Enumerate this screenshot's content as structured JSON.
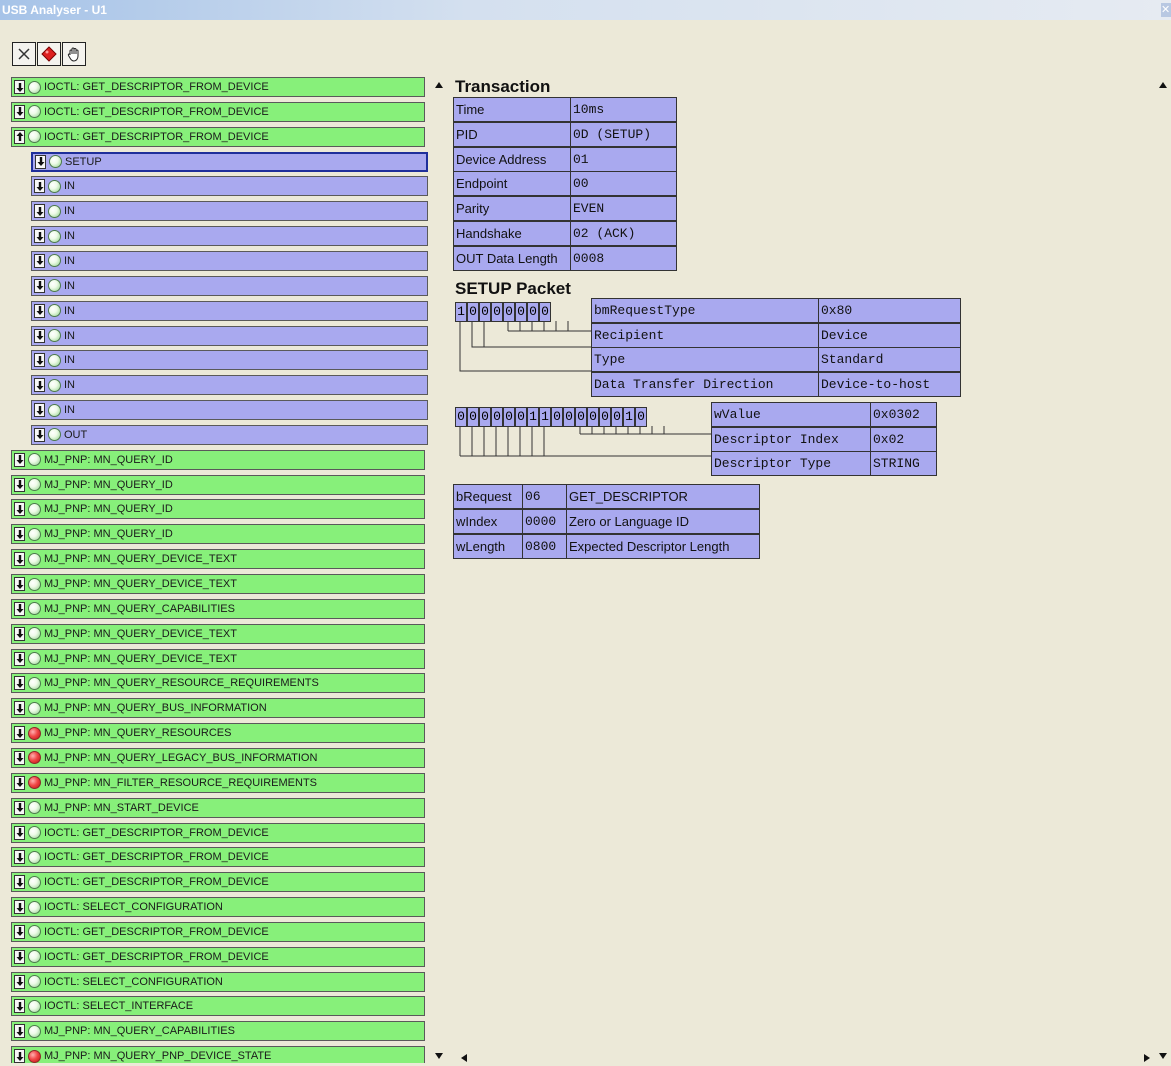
{
  "window": {
    "title": "USB Analyser - U1"
  },
  "toolbar": {
    "buttons": [
      {
        "name": "clear",
        "icon": "x-icon"
      },
      {
        "name": "stop",
        "icon": "stop-diamond-icon",
        "color": "#dd1f1f"
      },
      {
        "name": "pause",
        "icon": "hand-icon"
      }
    ]
  },
  "tree": {
    "rows": [
      {
        "label": "IOCTL: GET_DESCRIPTOR_FROM_DEVICE",
        "color": "green",
        "dir": "down",
        "led": "green",
        "indent": 0
      },
      {
        "label": "IOCTL: GET_DESCRIPTOR_FROM_DEVICE",
        "color": "green",
        "dir": "down",
        "led": "green",
        "indent": 0
      },
      {
        "label": "IOCTL: GET_DESCRIPTOR_FROM_DEVICE",
        "color": "green",
        "dir": "up",
        "led": "green",
        "indent": 0
      },
      {
        "label": "SETUP",
        "color": "blue",
        "dir": "down",
        "led": "green",
        "indent": 1,
        "selected": true
      },
      {
        "label": "IN",
        "color": "blue",
        "dir": "down",
        "led": "green",
        "indent": 1
      },
      {
        "label": "IN",
        "color": "blue",
        "dir": "down",
        "led": "green",
        "indent": 1
      },
      {
        "label": "IN",
        "color": "blue",
        "dir": "down",
        "led": "green",
        "indent": 1
      },
      {
        "label": "IN",
        "color": "blue",
        "dir": "down",
        "led": "green",
        "indent": 1
      },
      {
        "label": "IN",
        "color": "blue",
        "dir": "down",
        "led": "green",
        "indent": 1
      },
      {
        "label": "IN",
        "color": "blue",
        "dir": "down",
        "led": "green",
        "indent": 1
      },
      {
        "label": "IN",
        "color": "blue",
        "dir": "down",
        "led": "green",
        "indent": 1
      },
      {
        "label": "IN",
        "color": "blue",
        "dir": "down",
        "led": "green",
        "indent": 1
      },
      {
        "label": "IN",
        "color": "blue",
        "dir": "down",
        "led": "green",
        "indent": 1
      },
      {
        "label": "IN",
        "color": "blue",
        "dir": "down",
        "led": "green",
        "indent": 1
      },
      {
        "label": "OUT",
        "color": "blue",
        "dir": "down",
        "led": "green",
        "indent": 1
      },
      {
        "label": "MJ_PNP: MN_QUERY_ID",
        "color": "green",
        "dir": "down",
        "led": "green",
        "indent": 0
      },
      {
        "label": "MJ_PNP: MN_QUERY_ID",
        "color": "green",
        "dir": "down",
        "led": "green",
        "indent": 0
      },
      {
        "label": "MJ_PNP: MN_QUERY_ID",
        "color": "green",
        "dir": "down",
        "led": "green",
        "indent": 0
      },
      {
        "label": "MJ_PNP: MN_QUERY_ID",
        "color": "green",
        "dir": "down",
        "led": "green",
        "indent": 0
      },
      {
        "label": "MJ_PNP: MN_QUERY_DEVICE_TEXT",
        "color": "green",
        "dir": "down",
        "led": "green",
        "indent": 0
      },
      {
        "label": "MJ_PNP: MN_QUERY_DEVICE_TEXT",
        "color": "green",
        "dir": "down",
        "led": "green",
        "indent": 0
      },
      {
        "label": "MJ_PNP: MN_QUERY_CAPABILITIES",
        "color": "green",
        "dir": "down",
        "led": "green",
        "indent": 0
      },
      {
        "label": "MJ_PNP: MN_QUERY_DEVICE_TEXT",
        "color": "green",
        "dir": "down",
        "led": "green",
        "indent": 0
      },
      {
        "label": "MJ_PNP: MN_QUERY_DEVICE_TEXT",
        "color": "green",
        "dir": "down",
        "led": "green",
        "indent": 0
      },
      {
        "label": "MJ_PNP: MN_QUERY_RESOURCE_REQUIREMENTS",
        "color": "green",
        "dir": "down",
        "led": "green",
        "indent": 0
      },
      {
        "label": "MJ_PNP: MN_QUERY_BUS_INFORMATION",
        "color": "green",
        "dir": "down",
        "led": "green",
        "indent": 0
      },
      {
        "label": "MJ_PNP: MN_QUERY_RESOURCES",
        "color": "green",
        "dir": "down",
        "led": "red",
        "indent": 0
      },
      {
        "label": "MJ_PNP: MN_QUERY_LEGACY_BUS_INFORMATION",
        "color": "green",
        "dir": "down",
        "led": "red",
        "indent": 0
      },
      {
        "label": "MJ_PNP: MN_FILTER_RESOURCE_REQUIREMENTS",
        "color": "green",
        "dir": "down",
        "led": "red",
        "indent": 0
      },
      {
        "label": "MJ_PNP: MN_START_DEVICE",
        "color": "green",
        "dir": "down",
        "led": "green",
        "indent": 0
      },
      {
        "label": "IOCTL: GET_DESCRIPTOR_FROM_DEVICE",
        "color": "green",
        "dir": "down",
        "led": "green",
        "indent": 0
      },
      {
        "label": "IOCTL: GET_DESCRIPTOR_FROM_DEVICE",
        "color": "green",
        "dir": "down",
        "led": "green",
        "indent": 0
      },
      {
        "label": "IOCTL: GET_DESCRIPTOR_FROM_DEVICE",
        "color": "green",
        "dir": "down",
        "led": "green",
        "indent": 0
      },
      {
        "label": "IOCTL: SELECT_CONFIGURATION",
        "color": "green",
        "dir": "down",
        "led": "green",
        "indent": 0
      },
      {
        "label": "IOCTL: GET_DESCRIPTOR_FROM_DEVICE",
        "color": "green",
        "dir": "down",
        "led": "green",
        "indent": 0
      },
      {
        "label": "IOCTL: GET_DESCRIPTOR_FROM_DEVICE",
        "color": "green",
        "dir": "down",
        "led": "green",
        "indent": 0
      },
      {
        "label": "IOCTL: SELECT_CONFIGURATION",
        "color": "green",
        "dir": "down",
        "led": "green",
        "indent": 0
      },
      {
        "label": "IOCTL: SELECT_INTERFACE",
        "color": "green",
        "dir": "down",
        "led": "green",
        "indent": 0
      },
      {
        "label": "MJ_PNP: MN_QUERY_CAPABILITIES",
        "color": "green",
        "dir": "down",
        "led": "green",
        "indent": 0
      },
      {
        "label": "MJ_PNP: MN_QUERY_PNP_DEVICE_STATE",
        "color": "green",
        "dir": "down",
        "led": "red",
        "indent": 0
      }
    ]
  },
  "transaction": {
    "heading": "Transaction",
    "rows": [
      {
        "label": "Time",
        "value": "10ms"
      },
      {
        "label": "PID",
        "value": "0D (SETUP)"
      },
      {
        "label": "Device Address",
        "value": "01"
      },
      {
        "label": "Endpoint",
        "value": "00"
      },
      {
        "label": "Parity",
        "value": "EVEN"
      },
      {
        "label": "Handshake",
        "value": "02 (ACK)"
      },
      {
        "label": "OUT Data Length",
        "value": "0008"
      }
    ]
  },
  "setup": {
    "heading": "SETUP Packet",
    "bmRequestType": {
      "bits": [
        "1",
        "0",
        "0",
        "0",
        "0",
        "0",
        "0",
        "0"
      ],
      "rows": [
        {
          "label": "bmRequestType",
          "value": "0x80"
        },
        {
          "label": "Recipient",
          "value": "Device"
        },
        {
          "label": "Type",
          "value": "Standard"
        },
        {
          "label": "Data Transfer Direction",
          "value": "Device-to-host"
        }
      ]
    },
    "wValue": {
      "bits": [
        "0",
        "0",
        "0",
        "0",
        "0",
        "0",
        "1",
        "1",
        "0",
        "0",
        "0",
        "0",
        "0",
        "0",
        "1",
        "0"
      ],
      "rows": [
        {
          "label": "wValue",
          "value": "0x0302"
        },
        {
          "label": "Descriptor Index",
          "value": "0x02"
        },
        {
          "label": "Descriptor Type",
          "value": "STRING"
        }
      ]
    },
    "fields": [
      {
        "name": "bRequest",
        "value": "06",
        "desc": "GET_DESCRIPTOR"
      },
      {
        "name": "wIndex",
        "value": "0000",
        "desc": "Zero or Language ID"
      },
      {
        "name": "wLength",
        "value": "0800",
        "desc": "Expected Descriptor Length"
      }
    ]
  }
}
